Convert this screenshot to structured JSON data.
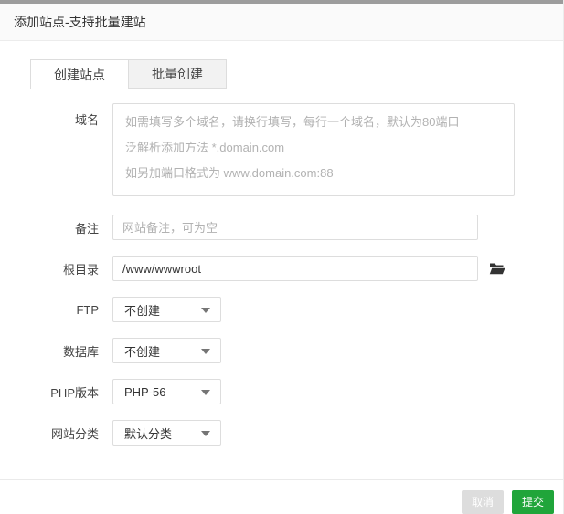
{
  "window": {
    "title": "添加站点-支持批量建站"
  },
  "tabs": [
    {
      "label": "创建站点",
      "active": true
    },
    {
      "label": "批量创建",
      "active": false
    }
  ],
  "form": {
    "domain": {
      "label": "域名",
      "placeholder": "如需填写多个域名，请换行填写，每行一个域名，默认为80端口\n泛解析添加方法 *.domain.com\n如另加端口格式为 www.domain.com:88"
    },
    "remark": {
      "label": "备注",
      "placeholder": "网站备注，可为空"
    },
    "root": {
      "label": "根目录",
      "value": "/www/wwwroot",
      "browse_icon": "folder-icon"
    },
    "ftp": {
      "label": "FTP",
      "value": "不创建"
    },
    "database": {
      "label": "数据库",
      "value": "不创建"
    },
    "php": {
      "label": "PHP版本",
      "value": "PHP-56"
    },
    "category": {
      "label": "网站分类",
      "value": "默认分类"
    }
  },
  "footer": {
    "cancel_label": "取消",
    "submit_label": "提交"
  },
  "colors": {
    "accent_green": "#20a53a",
    "cancel_gray": "#dddddd",
    "border_gray": "#dddddd",
    "top_strip_gray": "#9c9c9c"
  }
}
